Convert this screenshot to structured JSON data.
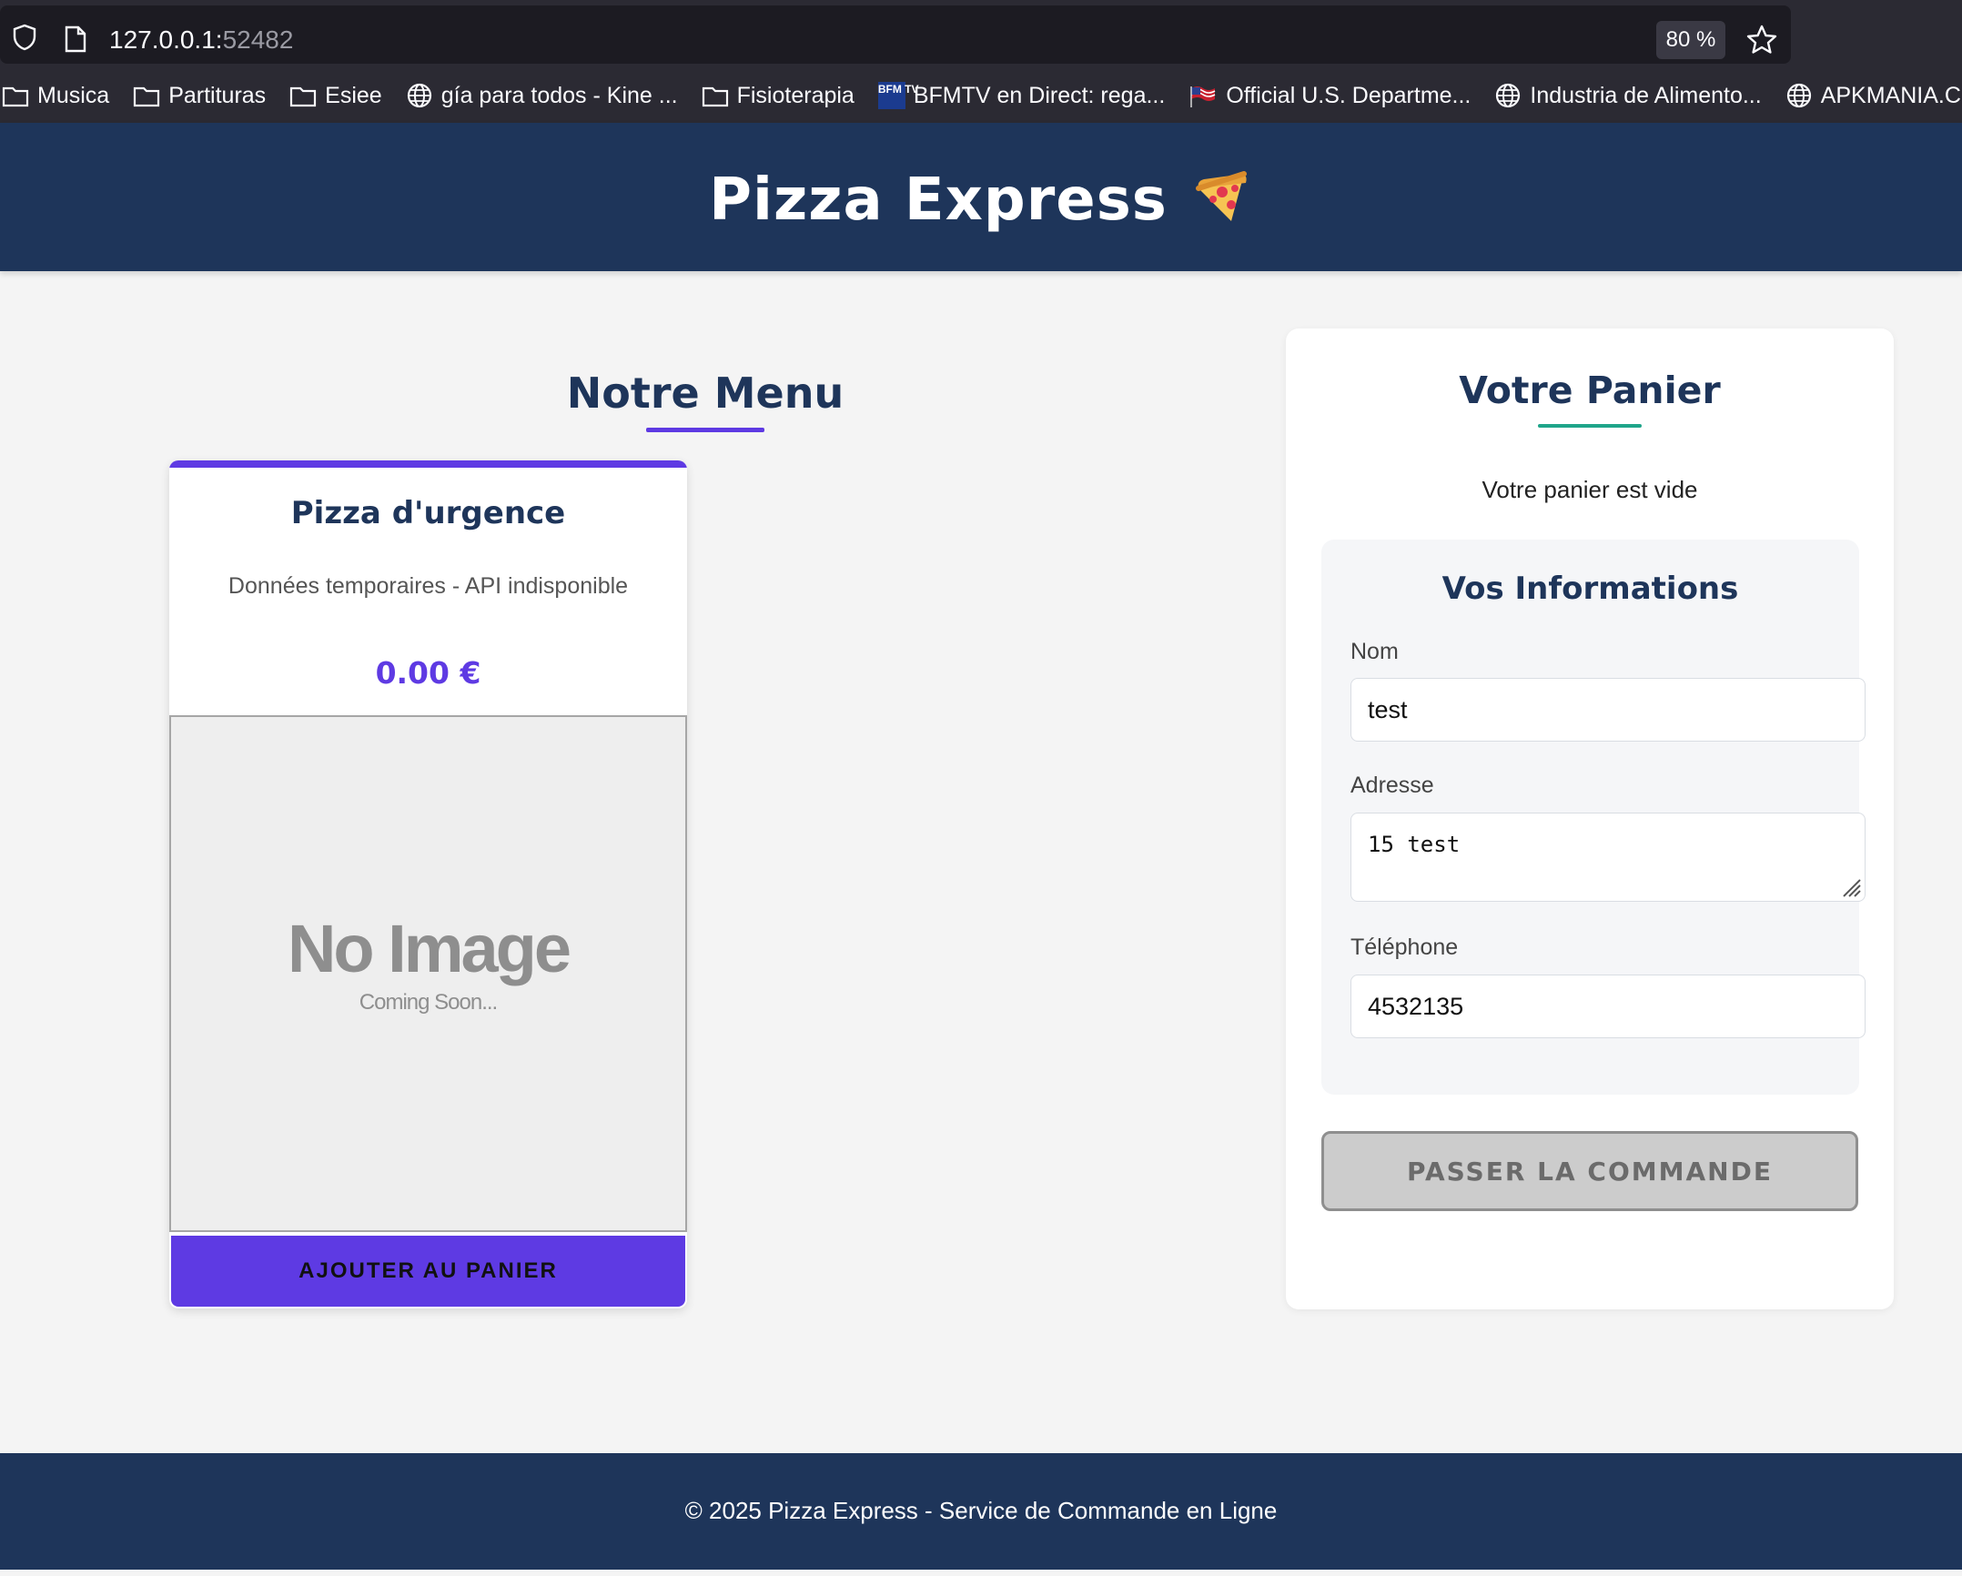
{
  "browser": {
    "url_host": "127.0.0.1:",
    "url_port": "52482",
    "zoom": "80 %",
    "bookmarks": [
      {
        "label": "Musica",
        "icon": "folder-icon"
      },
      {
        "label": "Partituras",
        "icon": "folder-icon"
      },
      {
        "label": "Esiee",
        "icon": "folder-icon"
      },
      {
        "label": "gía para todos - Kine ...",
        "icon": "globe-icon"
      },
      {
        "label": "Fisioterapia",
        "icon": "folder-icon"
      },
      {
        "label": "BFMTV en Direct: rega...",
        "icon": "bfmtv-icon"
      },
      {
        "label": "Official U.S. Departme...",
        "icon": "us-flag-icon"
      },
      {
        "label": "Industria de Alimento...",
        "icon": "globe-icon"
      },
      {
        "label": "APKMANIA.COM® - ...",
        "icon": "globe-icon"
      }
    ],
    "bfmtv_icon_text": "BFM TV"
  },
  "header": {
    "title": "Pizza Express"
  },
  "menu": {
    "heading": "Notre Menu",
    "items": [
      {
        "name": "Pizza d'urgence",
        "description": "Données temporaires - API indisponible",
        "price": "0.00 €",
        "image_placeholder_title": "No Image",
        "image_placeholder_subtitle": "Coming Soon...",
        "button_label": "AJOUTER AU PANIER"
      }
    ]
  },
  "cart": {
    "heading": "Votre Panier",
    "empty_message": "Votre panier est vide",
    "info": {
      "heading": "Vos Informations",
      "name_label": "Nom",
      "name_value": "test",
      "address_label": "Adresse",
      "address_value": "15 test",
      "phone_label": "Téléphone",
      "phone_value": "4532135"
    },
    "order_button_label": "PASSER LA COMMANDE"
  },
  "footer": {
    "text": "© 2025 Pizza Express - Service de Commande en Ligne"
  },
  "colors": {
    "brand_navy": "#1e355a",
    "accent_purple": "#5e3ae3",
    "accent_teal": "#1fa58a",
    "disabled_gray": "#cccccc"
  }
}
